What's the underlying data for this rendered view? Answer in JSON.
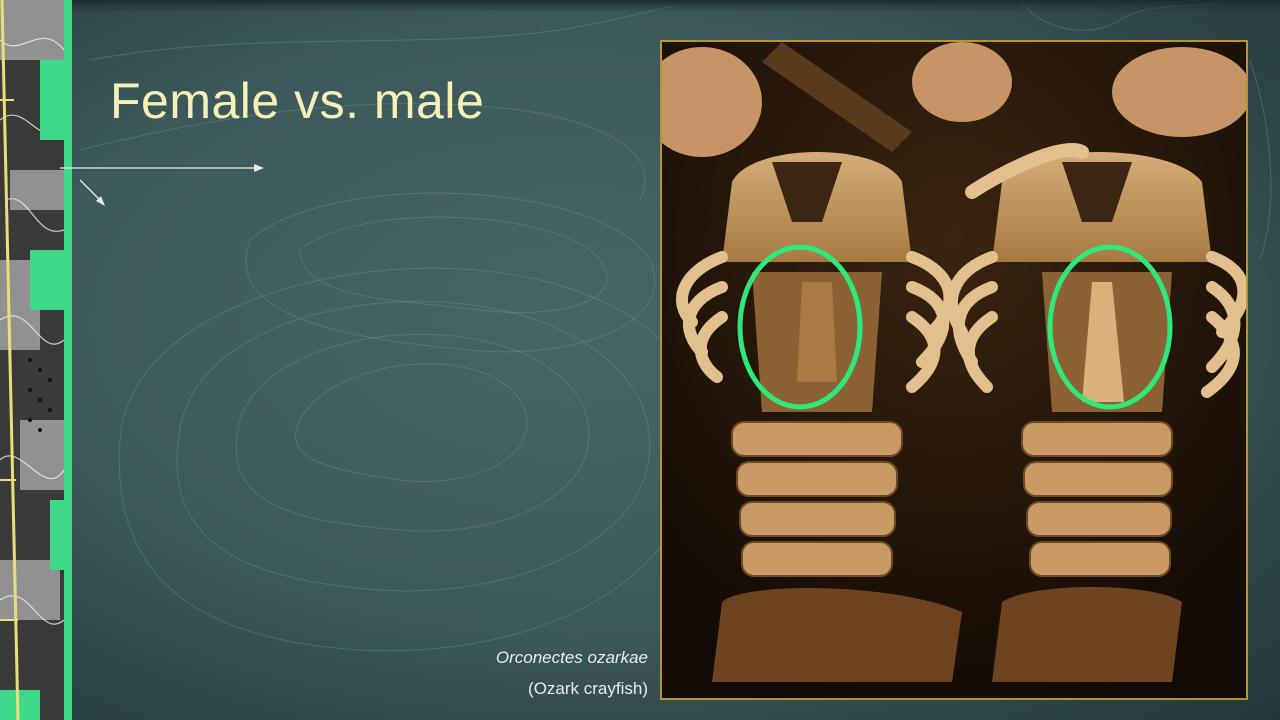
{
  "slide": {
    "title": "Female vs. male",
    "caption": {
      "scientific_name": "Orconectes ozarkae",
      "common_name": "(Ozark crayfish)"
    },
    "photo": {
      "subject_icon": "crayfish-ventral-photo",
      "highlight_color": "#2ee87a"
    }
  },
  "colors": {
    "background": "#3d5a5c",
    "title_text": "#f4f0b6",
    "accent_green": "#3fd98a",
    "frame_border": "#b39532"
  }
}
